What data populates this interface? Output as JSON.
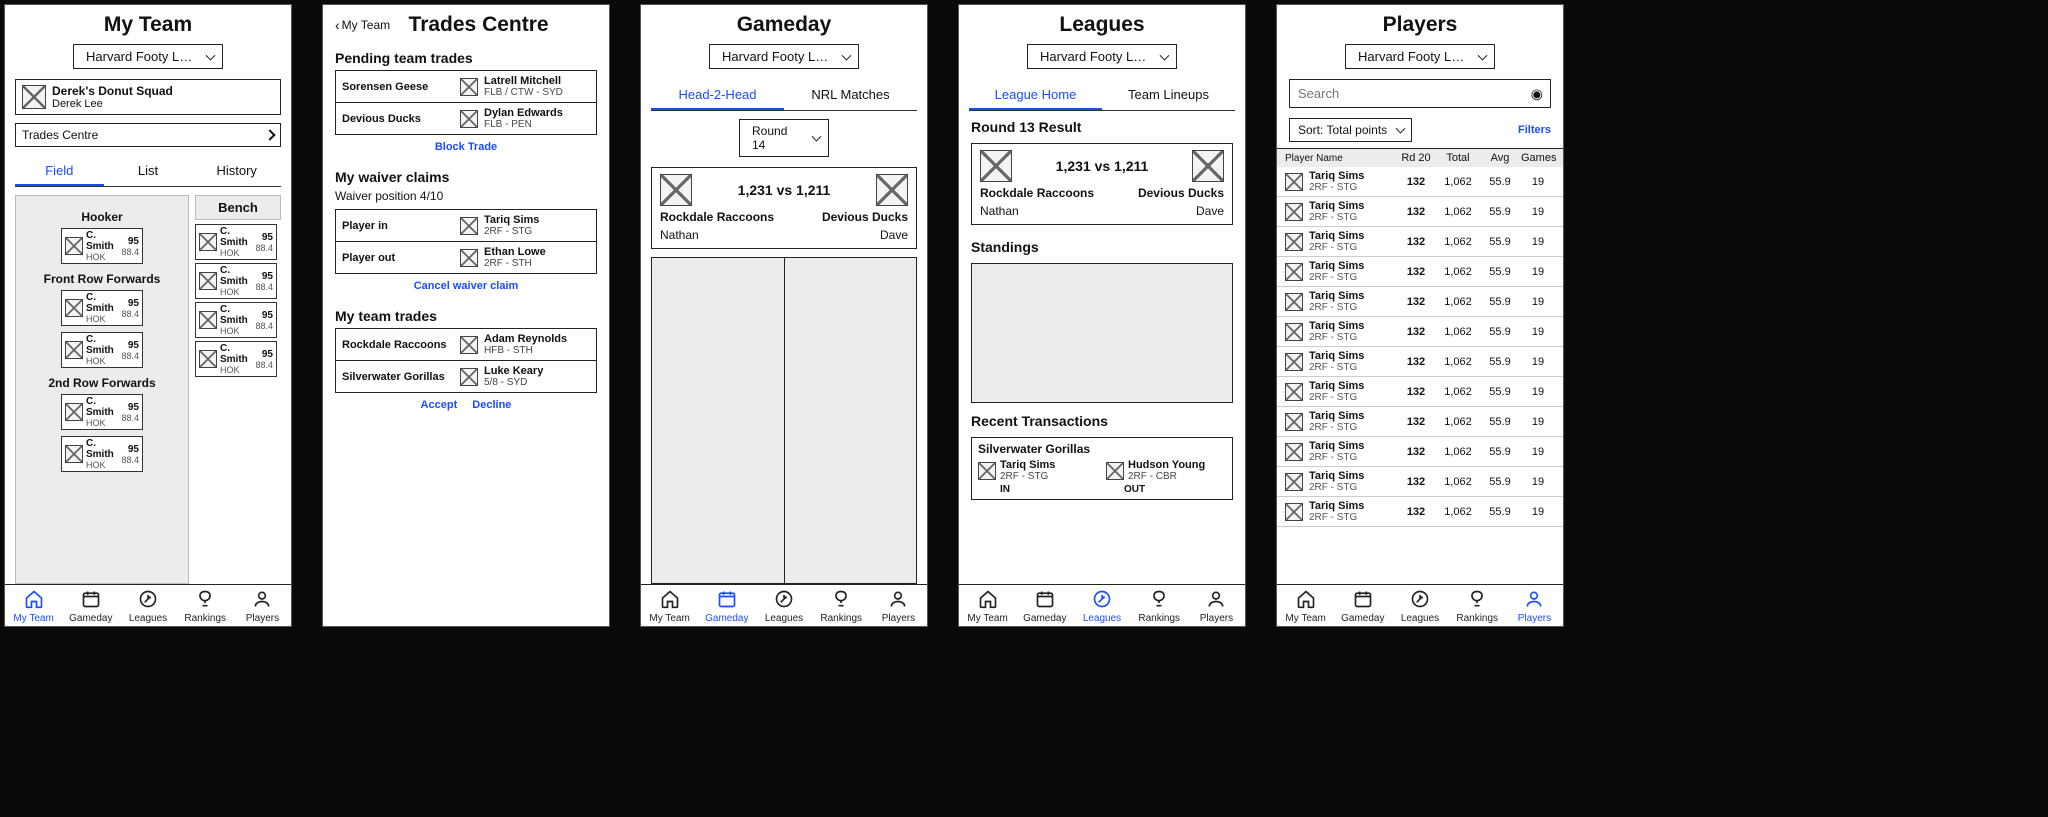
{
  "shared": {
    "league_selector": "Harvard Footy Leag…",
    "nav": {
      "myteam": "My Team",
      "gameday": "Gameday",
      "leagues": "Leagues",
      "rankings": "Rankings",
      "players": "Players"
    }
  },
  "myteam": {
    "title": "My Team",
    "team_name": "Derek's Donut Squad",
    "coach": "Derek Lee",
    "trades_link": "Trades Centre",
    "tabs": {
      "field": "Field",
      "list": "List",
      "history": "History"
    },
    "bench_label": "Bench",
    "positions": [
      {
        "label": "Hooker",
        "players": [
          {
            "name": "C. Smith",
            "pos": "HOK",
            "big": "95",
            "small": "88.4"
          }
        ]
      },
      {
        "label": "Front Row Forwards",
        "players": [
          {
            "name": "C. Smith",
            "pos": "HOK",
            "big": "95",
            "small": "88.4"
          },
          {
            "name": "C. Smith",
            "pos": "HOK",
            "big": "95",
            "small": "88.4"
          }
        ]
      },
      {
        "label": "2nd Row Forwards",
        "players": [
          {
            "name": "C. Smith",
            "pos": "HOK",
            "big": "95",
            "small": "88.4"
          },
          {
            "name": "C. Smith",
            "pos": "HOK",
            "big": "95",
            "small": "88.4"
          }
        ]
      }
    ],
    "bench": [
      {
        "name": "C. Smith",
        "pos": "HOK",
        "big": "95",
        "small": "88.4"
      },
      {
        "name": "C. Smith",
        "pos": "HOK",
        "big": "95",
        "small": "88.4"
      },
      {
        "name": "C. Smith",
        "pos": "HOK",
        "big": "95",
        "small": "88.4"
      },
      {
        "name": "C. Smith",
        "pos": "HOK",
        "big": "95",
        "small": "88.4"
      }
    ]
  },
  "trades": {
    "back": "My Team",
    "title": "Trades Centre",
    "pending_h": "Pending team trades",
    "pending": [
      {
        "team": "Sorensen Geese",
        "player": "Latrell Mitchell",
        "meta": "FLB / CTW - SYD"
      },
      {
        "team": "Devious Ducks",
        "player": "Dylan Edwards",
        "meta": "FLB - PEN"
      }
    ],
    "block_trade": "Block Trade",
    "waiver_h": "My waiver claims",
    "waiver_pos": "Waiver position 4/10",
    "waiver_in_label": "Player in",
    "waiver_out_label": "Player out",
    "waiver_in": {
      "player": "Tariq Sims",
      "meta": "2RF - STG"
    },
    "waiver_out": {
      "player": "Ethan Lowe",
      "meta": "2RF - STH"
    },
    "cancel_waiver": "Cancel waiver claim",
    "teamtrades_h": "My team trades",
    "teamtrades": [
      {
        "team": "Rockdale Raccoons",
        "player": "Adam Reynolds",
        "meta": "HFB - STH"
      },
      {
        "team": "Silverwater Gorillas",
        "player": "Luke Keary",
        "meta": "5/8 - SYD"
      }
    ],
    "accept": "Accept",
    "decline": "Decline"
  },
  "gameday": {
    "title": "Gameday",
    "tabs": {
      "h2h": "Head-2-Head",
      "nrl": "NRL Matches"
    },
    "round": "Round 14",
    "score": "1,231  vs  1,211",
    "home_team": "Rockdale Raccoons",
    "away_team": "Devious Ducks",
    "home_coach": "Nathan",
    "away_coach": "Dave"
  },
  "leagues": {
    "title": "Leagues",
    "tabs": {
      "home": "League Home",
      "lineups": "Team Lineups"
    },
    "result_h": "Round 13 Result",
    "score": "1,231  vs  1,211",
    "home_team": "Rockdale Raccoons",
    "away_team": "Devious Ducks",
    "home_coach": "Nathan",
    "away_coach": "Dave",
    "standings_h": "Standings",
    "tx_h": "Recent Transactions",
    "tx_team": "Silverwater Gorillas",
    "tx_in": {
      "player": "Tariq Sims",
      "meta": "2RF - STG"
    },
    "tx_out": {
      "player": "Hudson Young",
      "meta": "2RF - CBR"
    },
    "in_label": "IN",
    "out_label": "OUT"
  },
  "players": {
    "title": "Players",
    "search_placeholder": "Search",
    "sort": "Sort: Total points",
    "filters": "Filters",
    "cols": {
      "name": "Player Name",
      "rd": "Rd 20",
      "total": "Total",
      "avg": "Avg",
      "games": "Games"
    },
    "rows": [
      {
        "name": "Tariq Sims",
        "meta": "2RF - STG",
        "rd": "132",
        "total": "1,062",
        "avg": "55.9",
        "games": "19"
      },
      {
        "name": "Tariq Sims",
        "meta": "2RF - STG",
        "rd": "132",
        "total": "1,062",
        "avg": "55.9",
        "games": "19"
      },
      {
        "name": "Tariq Sims",
        "meta": "2RF - STG",
        "rd": "132",
        "total": "1,062",
        "avg": "55.9",
        "games": "19"
      },
      {
        "name": "Tariq Sims",
        "meta": "2RF - STG",
        "rd": "132",
        "total": "1,062",
        "avg": "55.9",
        "games": "19"
      },
      {
        "name": "Tariq Sims",
        "meta": "2RF - STG",
        "rd": "132",
        "total": "1,062",
        "avg": "55.9",
        "games": "19"
      },
      {
        "name": "Tariq Sims",
        "meta": "2RF - STG",
        "rd": "132",
        "total": "1,062",
        "avg": "55.9",
        "games": "19"
      },
      {
        "name": "Tariq Sims",
        "meta": "2RF - STG",
        "rd": "132",
        "total": "1,062",
        "avg": "55.9",
        "games": "19"
      },
      {
        "name": "Tariq Sims",
        "meta": "2RF - STG",
        "rd": "132",
        "total": "1,062",
        "avg": "55.9",
        "games": "19"
      },
      {
        "name": "Tariq Sims",
        "meta": "2RF - STG",
        "rd": "132",
        "total": "1,062",
        "avg": "55.9",
        "games": "19"
      },
      {
        "name": "Tariq Sims",
        "meta": "2RF - STG",
        "rd": "132",
        "total": "1,062",
        "avg": "55.9",
        "games": "19"
      },
      {
        "name": "Tariq Sims",
        "meta": "2RF - STG",
        "rd": "132",
        "total": "1,062",
        "avg": "55.9",
        "games": "19"
      },
      {
        "name": "Tariq Sims",
        "meta": "2RF - STG",
        "rd": "132",
        "total": "1,062",
        "avg": "55.9",
        "games": "19"
      }
    ]
  }
}
